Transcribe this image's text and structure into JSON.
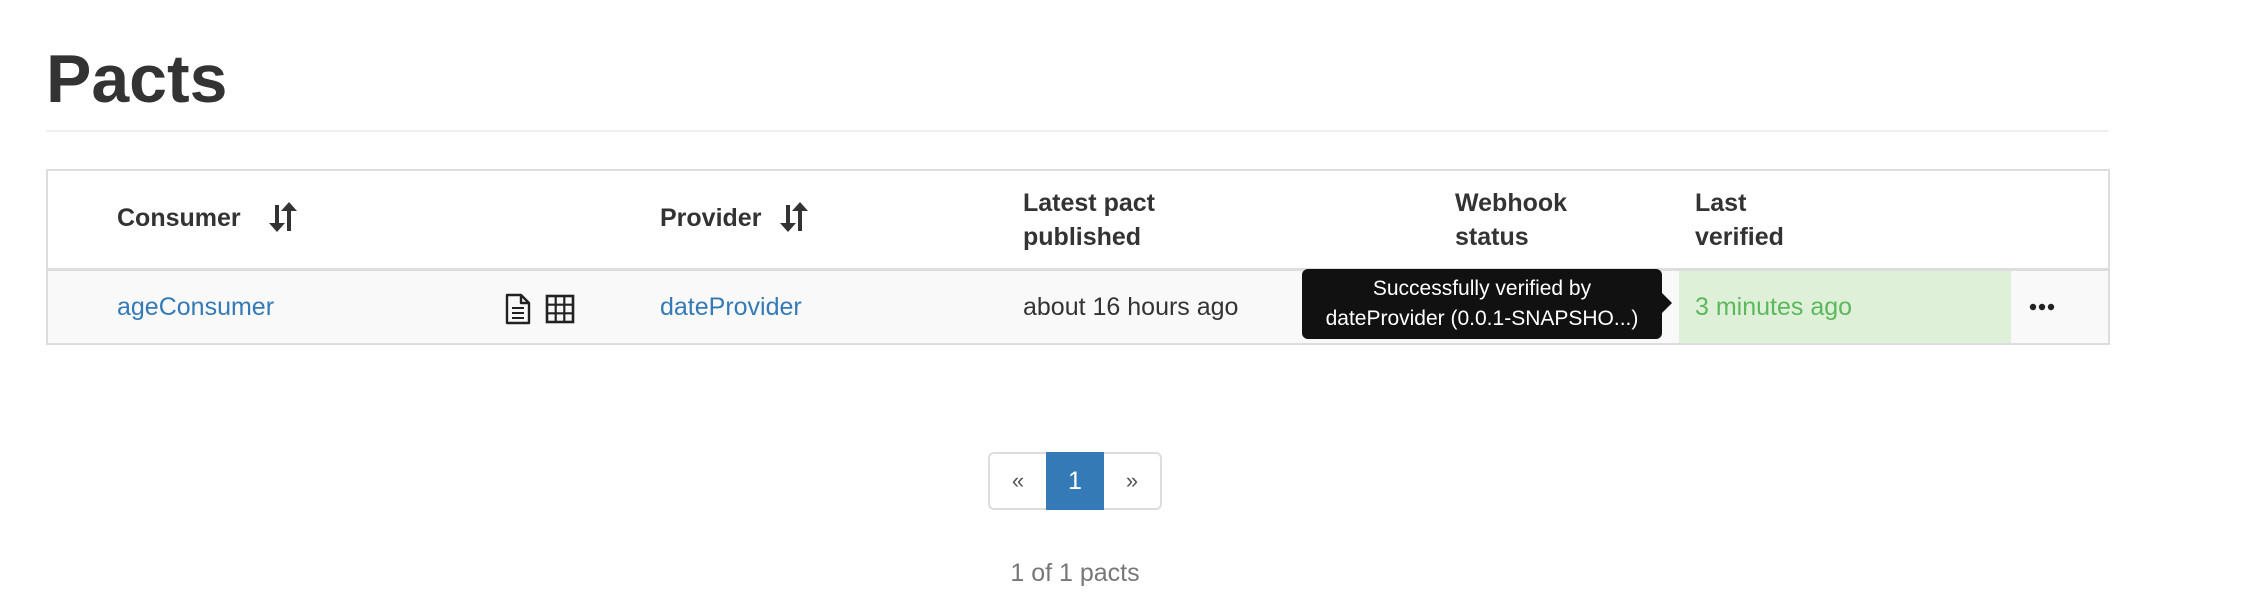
{
  "page": {
    "title": "Pacts"
  },
  "table": {
    "headers": {
      "consumer": "Consumer",
      "provider": "Provider",
      "latest_pact_line1": "Latest pact",
      "latest_pact_line2": "published",
      "webhook_line1": "Webhook",
      "webhook_line2": "status",
      "last_verified_line1": "Last",
      "last_verified_line2": "verified"
    },
    "icons": {
      "consumer_sort": "sort-icon",
      "provider_sort": "sort-icon",
      "pact_document": "document-icon",
      "matrix": "grid-icon",
      "actions": "ellipsis-icon"
    },
    "rows": [
      {
        "consumer": "ageConsumer",
        "provider": "dateProvider",
        "latest_pact_published": "about 16 hours ago",
        "last_verified": "3 minutes ago",
        "verification_status": "success"
      }
    ]
  },
  "tooltip": {
    "line1": "Successfully verified by",
    "line2": "dateProvider (0.0.1-SNAPSHO...)"
  },
  "pagination": {
    "prev_label": "«",
    "current_page": "1",
    "next_label": "»",
    "summary": "1 of 1 pacts"
  },
  "colors": {
    "link": "#337ab7",
    "success_bg": "#dff0d8",
    "success_text": "#5cb85c",
    "active_page": "#337ab7",
    "tooltip_bg": "#111111"
  }
}
